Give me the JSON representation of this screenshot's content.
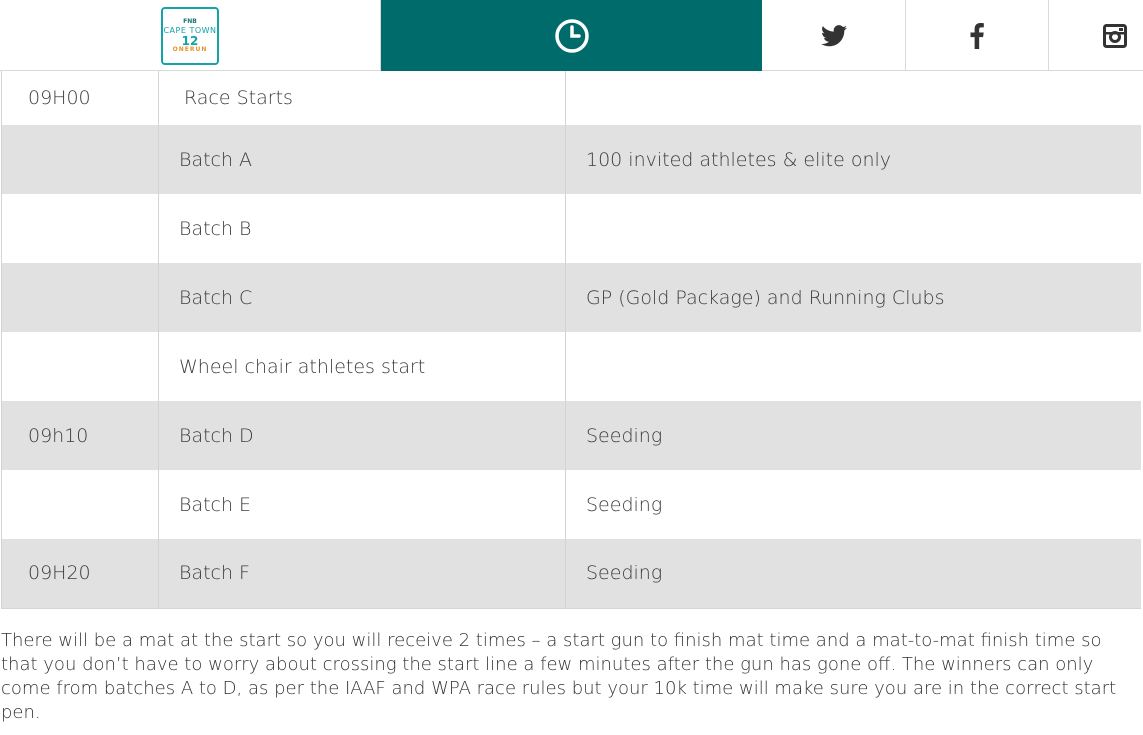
{
  "header": {
    "logo": {
      "fnb": "FNB",
      "line1": "CAPE TOWN",
      "twelve": "12",
      "onerun": "ONERUN"
    },
    "clock_icon": "clock-icon",
    "social": [
      {
        "name": "twitter-icon"
      },
      {
        "name": "facebook-icon"
      },
      {
        "name": "instagram-icon"
      }
    ],
    "accent_color": "#006b6b"
  },
  "schedule": {
    "rows": [
      {
        "time": "09H00",
        "event": "Race Starts",
        "note": ""
      },
      {
        "time": "",
        "event": "Batch A",
        "note": "100 invited athletes & elite only"
      },
      {
        "time": "",
        "event": "Batch B",
        "note": ""
      },
      {
        "time": "",
        "event": "Batch C",
        "note": "GP (Gold Package) and Running Clubs"
      },
      {
        "time": "",
        "event": "Wheel chair athletes start",
        "note": ""
      },
      {
        "time": "09h10",
        "event": "Batch D",
        "note": " Seeding"
      },
      {
        "time": "",
        "event": "Batch E",
        "note": " Seeding"
      },
      {
        "time": "09H20",
        "event": "Batch F",
        "note": " Seeding"
      }
    ]
  },
  "body_text": "There will be a mat at the start so you will receive 2 times – a start gun to finish mat time and a mat-to-mat finish time so that you don’t have to worry about crossing the start line a few minutes after the gun has gone off.  The winners can only come from batches A to D, as per the IAAF and WPA race rules but your 10k time will make sure you are in the correct start pen."
}
